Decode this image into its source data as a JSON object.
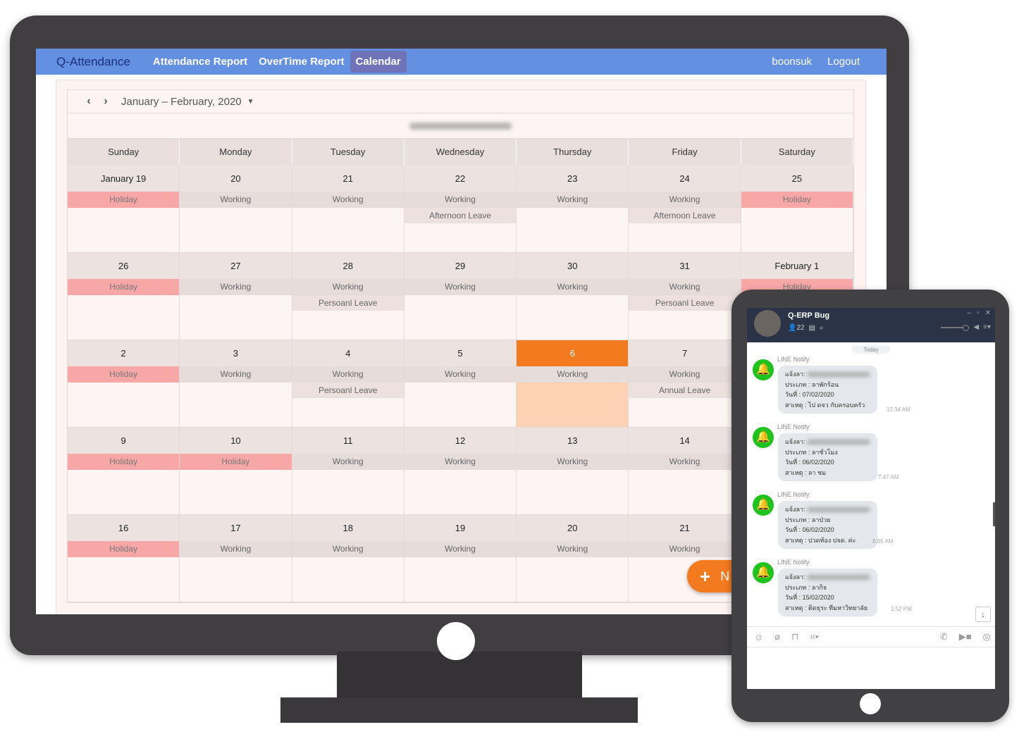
{
  "nav": {
    "brand": "Q-Attendance",
    "links": [
      "Attendance Report",
      "OverTime Report",
      "Calendar"
    ],
    "active": "Calendar",
    "user": "boonsuk",
    "logout": "Logout"
  },
  "calendar": {
    "range": "January – February, 2020",
    "days": [
      "Sunday",
      "Monday",
      "Tuesday",
      "Wednesday",
      "Thursday",
      "Friday",
      "Saturday"
    ],
    "weeks": [
      [
        {
          "d": "January 19",
          "s": "Holiday"
        },
        {
          "d": "20",
          "s": "Working"
        },
        {
          "d": "21",
          "s": "Working"
        },
        {
          "d": "22",
          "s": "Working",
          "l": "Afternoon Leave"
        },
        {
          "d": "23",
          "s": "Working"
        },
        {
          "d": "24",
          "s": "Working",
          "l": "Afternoon Leave"
        },
        {
          "d": "25",
          "s": "Holiday"
        }
      ],
      [
        {
          "d": "26",
          "s": "Holiday"
        },
        {
          "d": "27",
          "s": "Working"
        },
        {
          "d": "28",
          "s": "Working",
          "l": "Persoanl Leave"
        },
        {
          "d": "29",
          "s": "Working"
        },
        {
          "d": "30",
          "s": "Working"
        },
        {
          "d": "31",
          "s": "Working",
          "l": "Persoanl Leave"
        },
        {
          "d": "February 1",
          "s": "Holiday"
        }
      ],
      [
        {
          "d": "2",
          "s": "Holiday"
        },
        {
          "d": "3",
          "s": "Working"
        },
        {
          "d": "4",
          "s": "Working",
          "l": "Persoanl Leave"
        },
        {
          "d": "5",
          "s": "Working"
        },
        {
          "d": "6",
          "s": "Working",
          "today": true
        },
        {
          "d": "7",
          "s": "Working",
          "l": "Annual Leave"
        },
        {
          "d": "",
          "s": ""
        }
      ],
      [
        {
          "d": "9",
          "s": "Holiday"
        },
        {
          "d": "10",
          "s": "Holiday"
        },
        {
          "d": "11",
          "s": "Working"
        },
        {
          "d": "12",
          "s": "Working"
        },
        {
          "d": "13",
          "s": "Working"
        },
        {
          "d": "14",
          "s": "Working"
        },
        {
          "d": "",
          "s": ""
        }
      ],
      [
        {
          "d": "16",
          "s": "Holiday"
        },
        {
          "d": "17",
          "s": "Working"
        },
        {
          "d": "18",
          "s": "Working"
        },
        {
          "d": "19",
          "s": "Working"
        },
        {
          "d": "20",
          "s": "Working"
        },
        {
          "d": "21",
          "s": "Working"
        },
        {
          "d": "",
          "s": ""
        }
      ]
    ],
    "fab_label": "N",
    "colors": {
      "holiday": "#f8a7a7",
      "today": "#f47a20",
      "nav": "#6490e2"
    }
  },
  "line": {
    "group": "Q-ERP Bug",
    "members": "22",
    "today": "Today",
    "messages": [
      {
        "sender": "LINE Notify",
        "l1": "แจ้งลา:",
        "l2": "ประเภท : ลาพักร้อน",
        "l3": "วันที่ : 07/02/2020",
        "l4": "สาเหตุ : ไป ดจว กับครอบครัว",
        "time": "12:34 AM"
      },
      {
        "sender": "LINE Notify",
        "l1": "แจ้งลา:",
        "l2": "ประเภท : ลาชั่วโมง",
        "l3": "วันที่ : 06/02/2020",
        "l4": "สาเหตุ : ลา ชม",
        "time": "7:47 AM"
      },
      {
        "sender": "LINE Notify",
        "l1": "แจ้งลา:",
        "l2": "ประเภท : ลาป่วย",
        "l3": "วันที่ : 06/02/2020",
        "l4": "สาเหตุ : ปวดท้อง ปจด. ค่ะ",
        "time": "8:05 AM"
      },
      {
        "sender": "LINE Notify",
        "l1": "แจ้งลา:",
        "l2": "ประเภท : ลากิจ",
        "l3": "วันที่ : 15/02/2020",
        "l4": "สาเหตุ : ติดธุระ ทีมหาวิทยาลัย",
        "time": "1:52 PM"
      }
    ]
  }
}
